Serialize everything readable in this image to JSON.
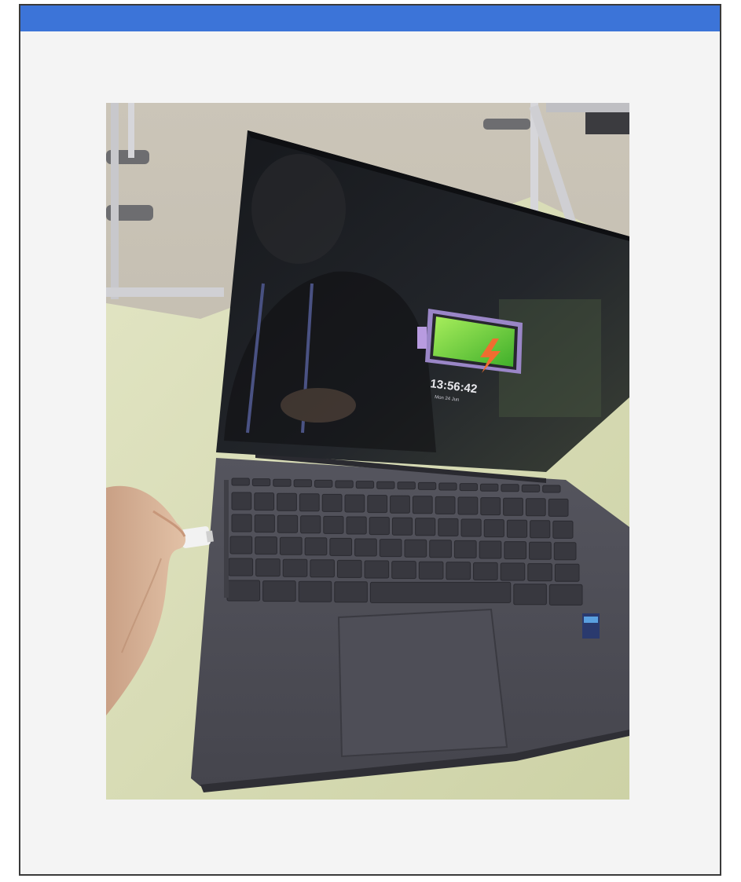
{
  "colors": {
    "header_bar": "#3c74d8",
    "panel_background": "#f4f4f4",
    "frame_border": "#3a3a3a",
    "desk": "#d9dcb8",
    "laptop_body": "#4b4b54",
    "screen": "#1b1d22",
    "battery_fill": "#6fd43a",
    "battery_frame": "#b89be0"
  },
  "photo": {
    "icons": [
      "laptop-photo",
      "battery-charging-icon",
      "usb-drive-icon",
      "hand-icon"
    ],
    "screen": {
      "battery_level": 0.95,
      "time_label": "13:56:42",
      "date_label": "Mon 24 Jun"
    }
  }
}
